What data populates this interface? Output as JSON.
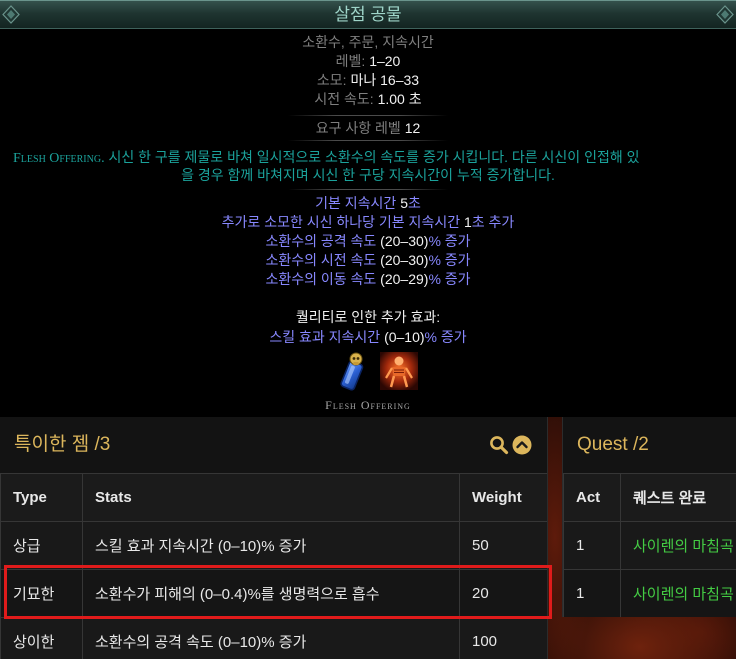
{
  "tooltip": {
    "title": "살점 공물",
    "tags": "소환수, 주문, 지속시간",
    "level": {
      "label": "레벨:",
      "value": "1–20"
    },
    "cost": {
      "label": "소모:",
      "value": "마나 16–33"
    },
    "cast_time": {
      "label": "시전 속도:",
      "value": "1.00 초"
    },
    "requirement": {
      "label": "요구 사항 레벨",
      "value": "12"
    },
    "description": {
      "name": "Flesh Offering.",
      "line1": "시신 한 구를 제물로 바쳐 일시적으로 소환수의 속도를 증가 시킵니다. 다른 시신이 인접해 있",
      "line2": "을 경우 함께 바쳐지며 시신 한 구당 지속시간이 누적 증가합니다."
    },
    "stats": [
      {
        "pre": "기본 지속시간 ",
        "value": "5",
        "post": "초"
      },
      {
        "pre": "추가로 소모한 시신 하나당 기본 지속시간 ",
        "value": "1",
        "post": "초 추가"
      },
      {
        "pre": "소환수의 공격 속도 ",
        "value": "(20–30)",
        "post": "% 증가"
      },
      {
        "pre": "소환수의 시전 속도 ",
        "value": "(20–30)",
        "post": "% 증가"
      },
      {
        "pre": "소환수의 이동 속도 ",
        "value": "(20–29)",
        "post": "% 증가"
      }
    ],
    "quality": {
      "header": "퀄리티로 인한 추가 효과:",
      "stat": {
        "pre": "스킬 효과 지속시간 ",
        "value": "(0–10)",
        "post": "% 증가"
      }
    },
    "icons": [
      "skill-gem-icon",
      "flesh-offering-skill-icon"
    ],
    "footer_name": "Flesh Offering"
  },
  "alt_gems": {
    "title": "특이한 젬 /3",
    "header_icons": [
      "search-icon",
      "chevron-up-icon"
    ],
    "columns": [
      "Type",
      "Stats",
      "Weight"
    ],
    "rows": [
      {
        "type": "상급",
        "stats": "스킬 효과 지속시간 (0–10)% 증가",
        "weight": "50",
        "highlighted": false
      },
      {
        "type": "기묘한",
        "stats": "소환수가 피해의 (0–0.4)%를 생명력으로 흡수",
        "weight": "20",
        "highlighted": true
      },
      {
        "type": "상이한",
        "stats": "소환수의 공격 속도 (0–10)% 증가",
        "weight": "100",
        "highlighted": false
      }
    ]
  },
  "quests": {
    "title": "Quest /2",
    "columns": [
      "Act",
      "퀘스트 완료"
    ],
    "rows": [
      {
        "act": "1",
        "quest": "사이렌의 마침곡"
      },
      {
        "act": "1",
        "quest": "사이렌의 마침곡"
      }
    ]
  },
  "colors": {
    "title_text": "#9fd5c9",
    "label_gray": "#7f7f7f",
    "value_white": "#f2f2f2",
    "mod_blue": "#8888ff",
    "gem_description": "#1ba29b",
    "section_gold": "#dcb65c",
    "quest_green": "#44cc44",
    "highlight_red": "#e01b1b"
  }
}
